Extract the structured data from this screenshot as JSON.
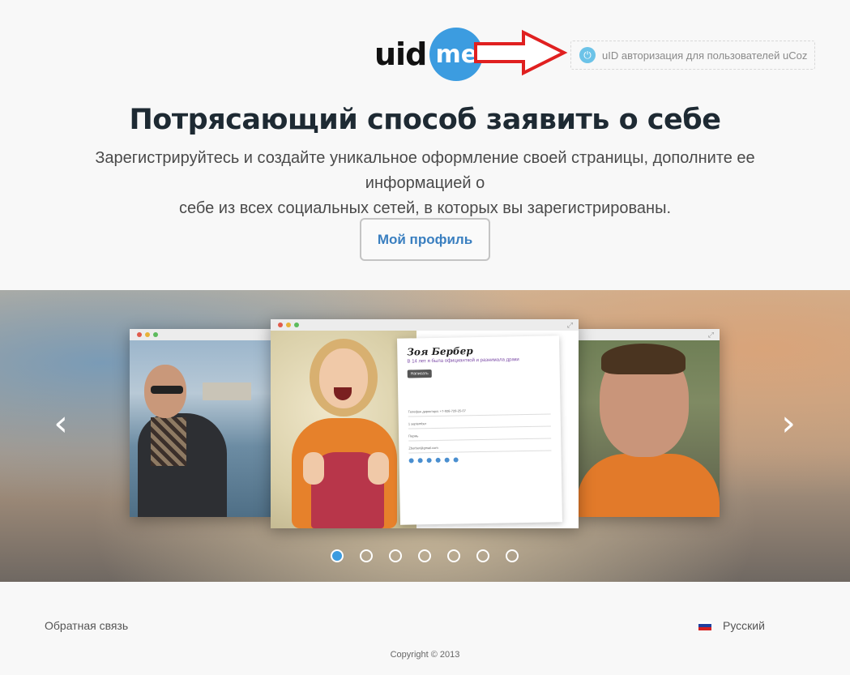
{
  "header": {
    "logo_uid": "uid",
    "logo_me": "me",
    "ucoz_badge": "uID авторизация для пользователей uCoz"
  },
  "hero": {
    "headline": "Потрясающий способ заявить о себе",
    "subline_1": "Зарегистрируйтесь и создайте уникальное оформление своей страницы, дополните ее информацией о",
    "subline_2": "себе из всех социальных сетей, в которых вы зарегистрированы.",
    "profile_button": "Мой профиль"
  },
  "carousel": {
    "prev_icon": "‹",
    "next_icon": "›",
    "slide_count": 7,
    "active_slide": 0,
    "card": {
      "name": "Зоя Бербер",
      "tagline": "В 14 лет я была официанткой и разнимала драки",
      "button": "Написать",
      "phone": "Телефон директора: +7-926-729-25-07",
      "birthday": "1 september",
      "city": "Пермь",
      "email": "Zberber@gmail.com"
    }
  },
  "footer": {
    "feedback": "Обратная связь",
    "language": "Русский",
    "copyright": "Copyright © 2013"
  },
  "colors": {
    "accent": "#3c9ce0",
    "arrow": "#e02020",
    "button_text": "#3a7fc0"
  }
}
